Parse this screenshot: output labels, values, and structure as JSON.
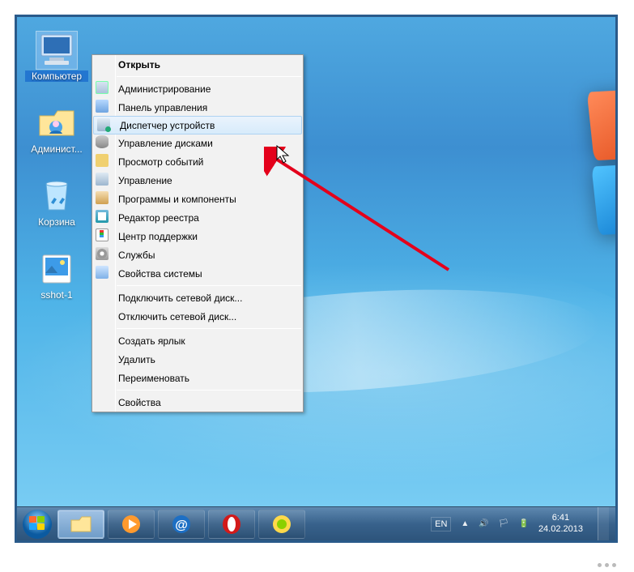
{
  "desktop": {
    "icons": [
      {
        "id": "computer",
        "label": "Компьютер",
        "selected": true
      },
      {
        "id": "admin",
        "label": "Админист..."
      },
      {
        "id": "recycle",
        "label": "Корзина"
      },
      {
        "id": "sshot",
        "label": "sshot-1"
      }
    ]
  },
  "context_menu": {
    "header": "Открыть",
    "highlighted_index": 2,
    "groups": [
      [
        {
          "label": "Администрирование",
          "icon": "i-admin"
        },
        {
          "label": "Панель управления",
          "icon": "i-panel"
        },
        {
          "label": "Диспетчер устройств",
          "icon": "i-devmgr"
        },
        {
          "label": "Управление дисками",
          "icon": "i-disk"
        },
        {
          "label": "Просмотр событий",
          "icon": "i-event"
        },
        {
          "label": "Управление",
          "icon": "i-manage"
        },
        {
          "label": "Программы и компоненты",
          "icon": "i-prog"
        },
        {
          "label": "Редактор реестра",
          "icon": "i-reg"
        },
        {
          "label": "Центр поддержки",
          "icon": "i-action"
        },
        {
          "label": "Службы",
          "icon": "i-svc"
        },
        {
          "label": "Свойства системы",
          "icon": "i-sysprop"
        }
      ],
      [
        {
          "label": "Подключить сетевой диск..."
        },
        {
          "label": "Отключить сетевой диск..."
        }
      ],
      [
        {
          "label": "Создать ярлык"
        },
        {
          "label": "Удалить"
        },
        {
          "label": "Переименовать"
        }
      ],
      [
        {
          "label": "Свойства"
        }
      ]
    ]
  },
  "taskbar": {
    "pinned": [
      {
        "id": "explorer",
        "active": true
      },
      {
        "id": "wmplayer"
      },
      {
        "id": "mail"
      },
      {
        "id": "opera"
      },
      {
        "id": "globe"
      }
    ],
    "lang": "EN",
    "time": "6:41",
    "date": "24.02.2013"
  }
}
